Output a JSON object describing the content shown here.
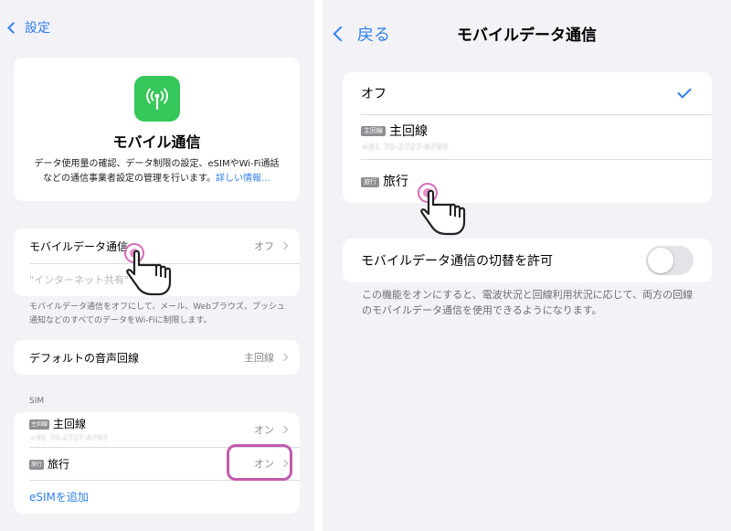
{
  "left": {
    "back_label": "設定",
    "hero": {
      "icon": "antenna-icon",
      "title": "モバイル通信",
      "desc": "データ使用量の確認、データ制限の設定、eSIMやWi-Fi通話などの通信事業者設定の管理を行います。",
      "link": "詳しい情報…"
    },
    "mobile_data": {
      "label": "モバイルデータ通信",
      "value": "オフ",
      "hotspot": "\"インターネット共有\""
    },
    "mobile_footnote": "モバイルデータ通信をオフにして、メール、Webブラウズ、プッシュ通知などのすべてのデータをWi-Fiに制限します。",
    "default_voice": {
      "label": "デフォルトの音声回線",
      "value": "主回線"
    },
    "sim_header": "SIM",
    "sim_lines": [
      {
        "badge": "主回線",
        "label": "主回線",
        "number": "+81 70-2727-6793",
        "value": "オン"
      },
      {
        "badge": "旅行",
        "label": "旅行",
        "value": "オン"
      }
    ],
    "add_esim": "eSIMを追加"
  },
  "right": {
    "back_label": "戻る",
    "title": "モバイルデータ通信",
    "options": [
      {
        "label": "オフ",
        "selected": true
      },
      {
        "badge": "主回線",
        "label": "主回線",
        "number": "+81 70-2727-6793"
      },
      {
        "badge": "旅行",
        "label": "旅行"
      }
    ],
    "switch_label": "モバイルデータ通信の切替を許可",
    "switch_on": false,
    "switch_footnote": "この機能をオンにすると、電波状況と回線利用状況に応じて、両方の回線のモバイルデータ通信を使用できるようになります。"
  },
  "colors": {
    "accent": "#2f80ed",
    "app_icon": "#35c759",
    "highlight": "#c25aac",
    "background": "#f2f2f7"
  }
}
